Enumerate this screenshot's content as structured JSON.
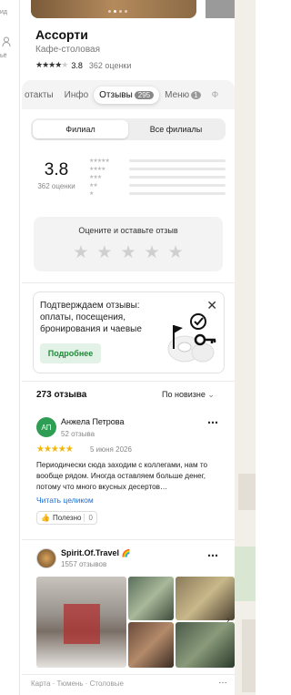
{
  "rail": {
    "label_top": "ид",
    "label_mid": "ьё"
  },
  "place": {
    "title": "Ассорти",
    "subtitle": "Кафе-столовая",
    "rating": "3.8",
    "rating_count": "362 оценки",
    "stars_filled": 4
  },
  "tabs": [
    {
      "label": "отакты"
    },
    {
      "label": "Инфо"
    },
    {
      "label": "Отзывы",
      "badge": "295"
    },
    {
      "label": "Меню",
      "badge": "1"
    },
    {
      "label": "Ф"
    }
  ],
  "filter": {
    "branch": "Филиал",
    "all": "Все филиалы"
  },
  "summary": {
    "score": "3.8",
    "count": "362 оценки"
  },
  "rate_box": {
    "title": "Оцените и оставьте отзыв"
  },
  "promo": {
    "text": "Подтверждаем отзывы: оплаты, посещения, бронирования и чаевые",
    "button": "Подробнее",
    "close": "✕"
  },
  "reviews_header": {
    "count": "273 отзыва",
    "sort": "По новизне"
  },
  "reviews": [
    {
      "initials": "АП",
      "name": "Анжела Петрова",
      "meta": "52 отзыва",
      "stars": "★★★★★",
      "date": "5 июня 2026",
      "text": "Периодически сюда заходим с коллегами, нам то вообще рядом. Иногда оставляем больше денег, потому что много вкусных десертов…",
      "read_more": "Читать целиком",
      "useful": "Полезно",
      "useful_count": "0",
      "avatar_color": "#2f9e55"
    },
    {
      "name": "Spirit.Of.Travel",
      "meta": "1557 отзывов"
    }
  ],
  "footer": {
    "breadcrumb": "Карта · Тюмень · Столовые",
    "more": "…"
  },
  "colors": {
    "accent": "#218a3a",
    "link": "#1a6ed8",
    "star": "#f2b705"
  }
}
